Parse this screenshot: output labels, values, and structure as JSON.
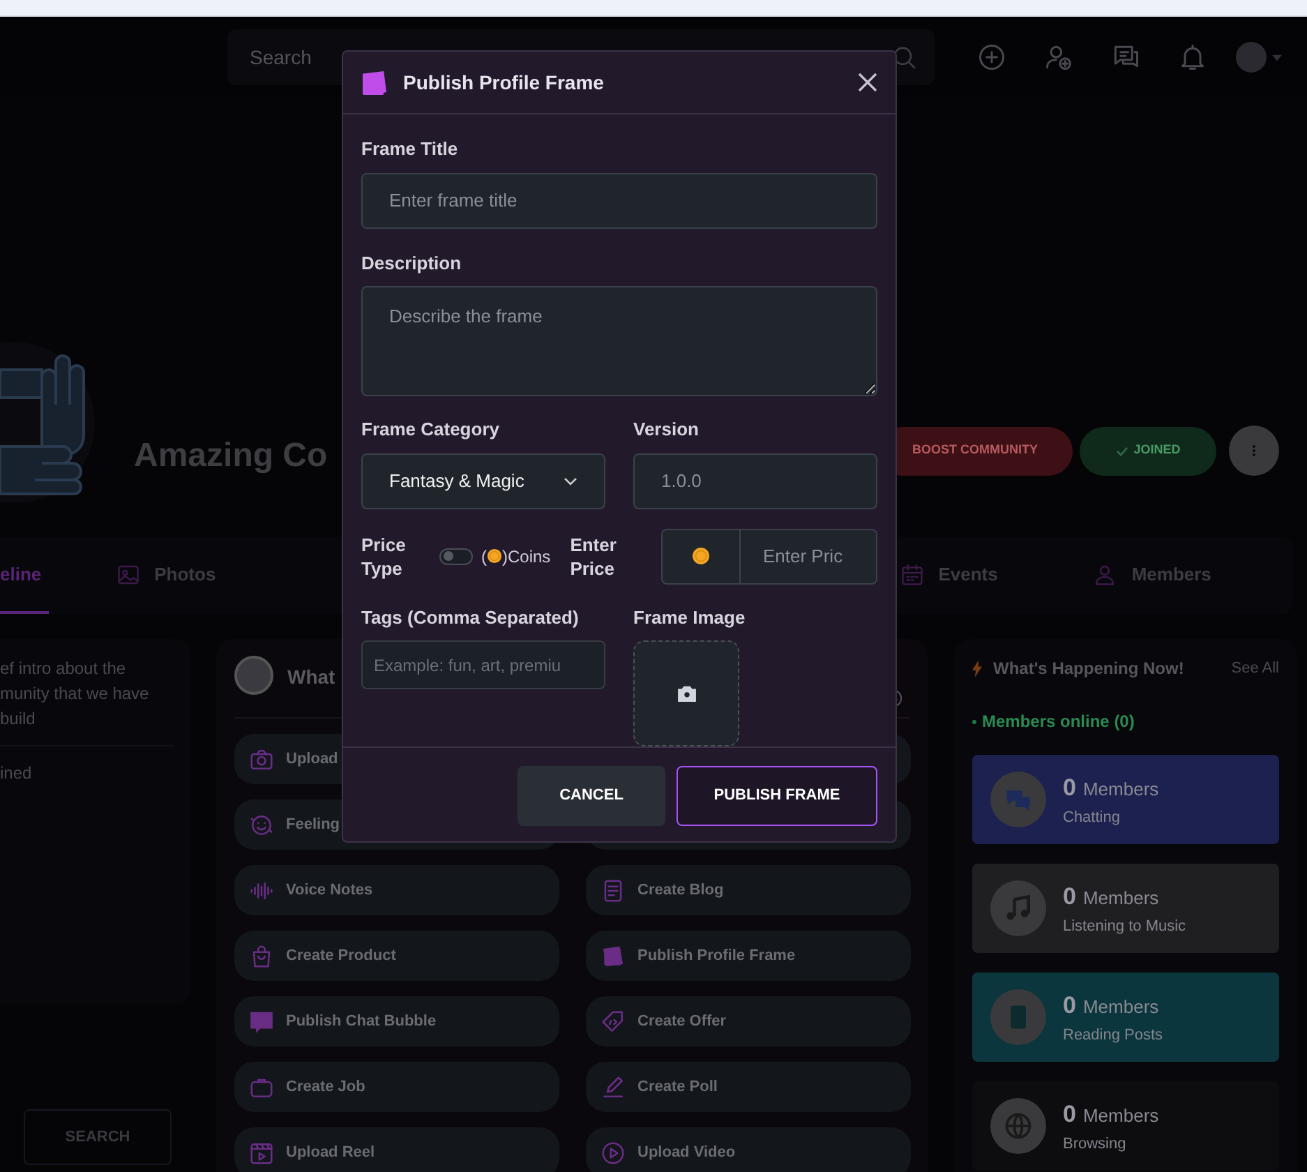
{
  "header": {
    "search_placeholder": "Search"
  },
  "community": {
    "title": "Amazing Co",
    "buttons": [
      {
        "kind": "boost",
        "label": "BOOST COMMUNITY"
      },
      {
        "kind": "joined",
        "label": "JOINED"
      }
    ]
  },
  "tabs": [
    {
      "kind": "timeline",
      "label": "eline",
      "selected": true
    },
    {
      "kind": "photos",
      "label": "Photos",
      "selected": false
    },
    {
      "kind": "events",
      "label": "Events",
      "selected": false
    },
    {
      "kind": "members",
      "label": "Members",
      "selected": false
    }
  ],
  "about": {
    "intro": "ef intro about the\nmunity that we have\nbuild",
    "status": "ined",
    "search_button": "SEARCH"
  },
  "composer": {
    "prompt": "What",
    "actions_left": [
      {
        "kind": "camera",
        "label": "Upload"
      },
      {
        "kind": "feeling",
        "label": "Feeling"
      },
      {
        "kind": "voice",
        "label": "Voice Notes"
      },
      {
        "kind": "product",
        "label": "Create Product"
      },
      {
        "kind": "bubble",
        "label": "Publish Chat Bubble"
      },
      {
        "kind": "job",
        "label": "Create Job"
      },
      {
        "kind": "reel",
        "label": "Upload Reel"
      }
    ],
    "actions_right": [
      {
        "kind": "blog",
        "label": "Create Blog"
      },
      {
        "kind": "frame",
        "label": "Publish Profile Frame"
      },
      {
        "kind": "offer",
        "label": "Create Offer"
      },
      {
        "kind": "poll",
        "label": "Create Poll"
      },
      {
        "kind": "video",
        "label": "Upload Video"
      }
    ]
  },
  "happening": {
    "title": "What's Happening Now!",
    "see_all": "See All",
    "online": "Members online (0)",
    "stats": [
      {
        "kind": "chat",
        "count": "0",
        "unit": "Members",
        "activity": "Chatting",
        "color": "#1d2150"
      },
      {
        "kind": "music",
        "count": "0",
        "unit": "Members",
        "activity": "Listening to Music",
        "color": "#1f1f22"
      },
      {
        "kind": "book",
        "count": "0",
        "unit": "Members",
        "activity": "Reading Posts",
        "color": "#0b363d"
      },
      {
        "kind": "globe",
        "count": "0",
        "unit": "Members",
        "activity": "Browsing",
        "color": "#0d0d10"
      }
    ]
  },
  "modal": {
    "title": "Publish Profile Frame",
    "frame_title": {
      "label": "Frame Title",
      "placeholder": "Enter frame title"
    },
    "description": {
      "label": "Description",
      "placeholder": "Describe the frame"
    },
    "category": {
      "label": "Frame Category",
      "value": "Fantasy & Magic"
    },
    "version": {
      "label": "Version",
      "placeholder": "1.0.0"
    },
    "price_type": {
      "label": "Price Type",
      "on": false,
      "open": "(",
      "coins": ")Coins"
    },
    "price": {
      "label": "Enter Price",
      "placeholder": "Enter Pric"
    },
    "tags": {
      "label": "Tags (Comma Separated)",
      "placeholder": "Example: fun, art, premiu"
    },
    "image": {
      "label": "Frame Image"
    },
    "buttons": [
      {
        "kind": "cancel",
        "label": "CANCEL"
      },
      {
        "kind": "primary",
        "label": "PUBLISH FRAME"
      }
    ]
  }
}
